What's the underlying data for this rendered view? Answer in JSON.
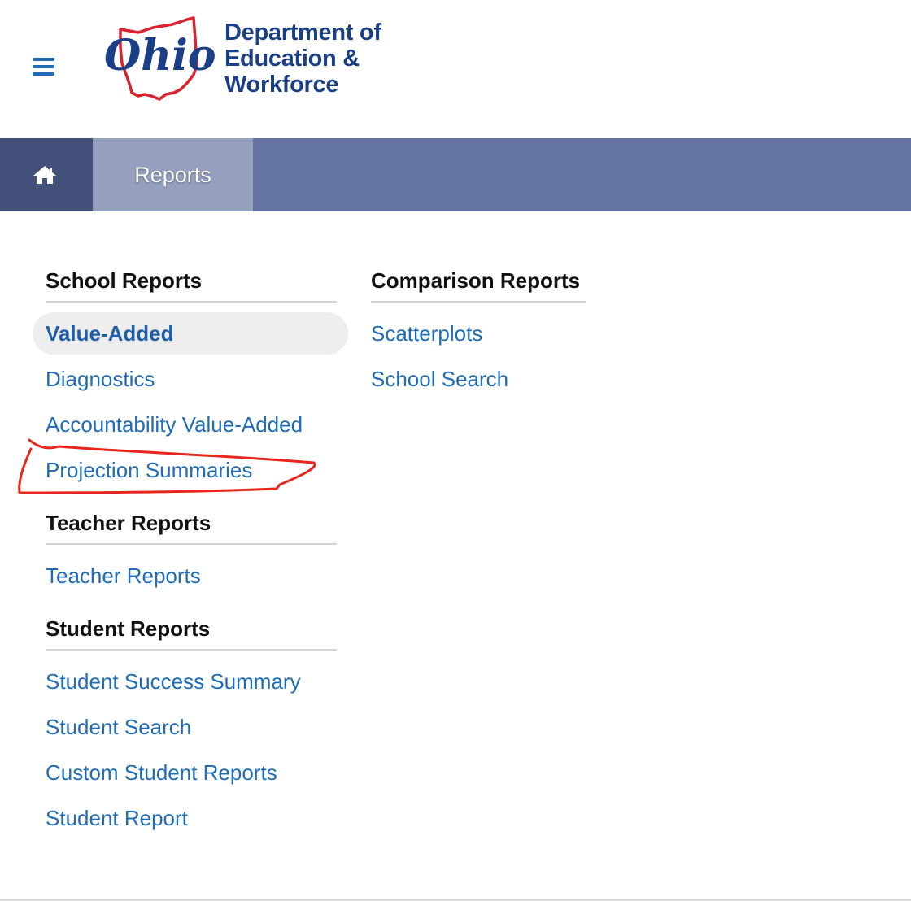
{
  "header": {
    "logo_wordmark": "Ohio",
    "org_name_lines": [
      "Department of",
      "Education &",
      "Workforce"
    ]
  },
  "nav": {
    "home_icon": "home-icon",
    "reports_label": "Reports"
  },
  "menu": {
    "school_reports": {
      "heading": "School Reports",
      "items": [
        "Value-Added",
        "Diagnostics",
        "Accountability Value-Added",
        "Projection Summaries"
      ],
      "active_item": "Value-Added"
    },
    "teacher_reports": {
      "heading": "Teacher Reports",
      "items": [
        "Teacher Reports"
      ]
    },
    "student_reports": {
      "heading": "Student Reports",
      "items": [
        "Student Success Summary",
        "Student Search",
        "Custom Student Reports",
        "Student Report"
      ]
    },
    "comparison_reports": {
      "heading": "Comparison Reports",
      "items": [
        "Scatterplots",
        "School Search"
      ]
    }
  },
  "colors": {
    "link": "#1f6cb8",
    "nav_bar": "#6573a3",
    "nav_home": "#43507a",
    "nav_active": "#959fbe",
    "annotation": "#e8261c"
  }
}
